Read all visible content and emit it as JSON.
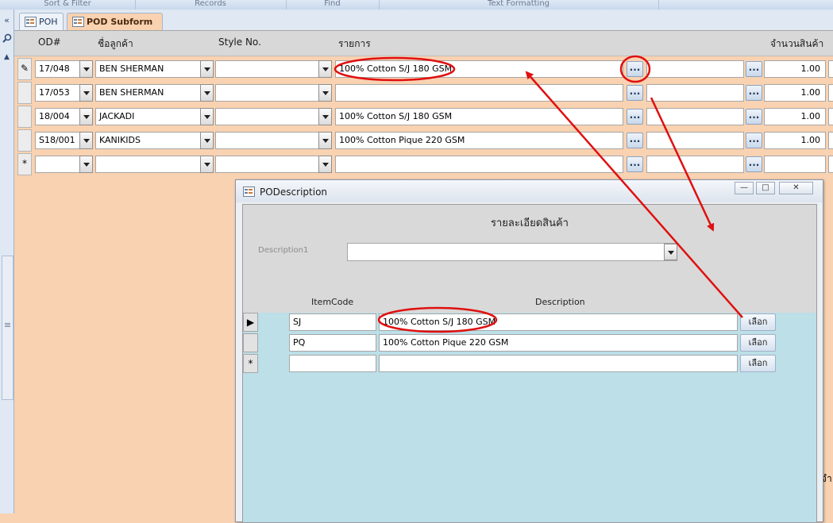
{
  "ribbon": {
    "groups": [
      "Sort & Filter",
      "Records",
      "Find",
      "Text Formatting"
    ]
  },
  "nav": {
    "collapse_glyph": "«",
    "search_icon": "search-icon"
  },
  "tabs": [
    {
      "label": "POH",
      "active": false
    },
    {
      "label": "POD Subform",
      "active": true
    }
  ],
  "columns": {
    "od": "OD#",
    "customer": "ชื่อลูกค้า",
    "style": "Style No.",
    "item": "รายการ",
    "qty": "จำนวนสินค้า"
  },
  "rows": [
    {
      "selector": "✎",
      "od": "17/048",
      "customer": "BEN SHERMAN",
      "style": "",
      "item": "100% Cotton S/J 180 GSM",
      "extra": "",
      "ellipsis": "...",
      "qty": "1.00"
    },
    {
      "selector": "",
      "od": "17/053",
      "customer": "BEN SHERMAN",
      "style": "",
      "item": "",
      "extra": "",
      "ellipsis": "...",
      "qty": "1.00"
    },
    {
      "selector": "",
      "od": "18/004",
      "customer": "JACKADI",
      "style": "",
      "item": "100% Cotton S/J 180 GSM",
      "extra": "",
      "ellipsis": "...",
      "qty": "1.00"
    },
    {
      "selector": "",
      "od": "S18/001",
      "customer": "KANIKIDS",
      "style": "",
      "item": "100% Cotton Pique 220 GSM",
      "extra": "",
      "ellipsis": "...",
      "qty": "1.00"
    },
    {
      "selector": "*",
      "od": "",
      "customer": "",
      "style": "",
      "item": "",
      "extra": "",
      "ellipsis": "...",
      "qty": ""
    }
  ],
  "edge_text": "จำ",
  "popup": {
    "title": "PODescription",
    "heading": "รายละเอียดสินค้า",
    "filter_label": "Description1",
    "filter_value": "",
    "col_itemcode": "ItemCode",
    "col_description": "Description",
    "rows": [
      {
        "selector": "▶",
        "itemcode": "SJ",
        "description": "100% Cotton S/J 180 GSM",
        "button": "เลือก"
      },
      {
        "selector": "",
        "itemcode": "PQ",
        "description": "100% Cotton Pique 220 GSM",
        "button": "เลือก"
      },
      {
        "selector": "*",
        "itemcode": "",
        "description": "",
        "button": "เลือก"
      }
    ],
    "window_buttons": {
      "minimize": "—",
      "maximize": "□",
      "close": "✕"
    }
  },
  "annotation_color": "#e01010"
}
